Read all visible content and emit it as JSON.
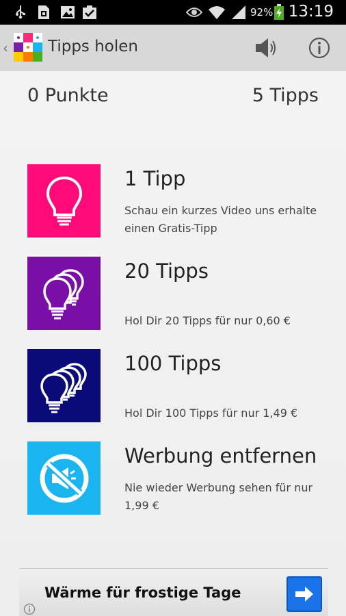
{
  "status_bar": {
    "battery_percent": "92%",
    "time": "13:19",
    "icons": [
      "usb-icon",
      "sim-icon",
      "gallery-icon",
      "task-icon",
      "eye-icon",
      "wifi-icon",
      "signal-icon",
      "battery-icon"
    ]
  },
  "action_bar": {
    "title": "Tipps holen",
    "icons": [
      "back-icon",
      "app-logo-icon",
      "sound-icon",
      "info-icon"
    ]
  },
  "score": {
    "points": "0 Punkte",
    "tips": "5 Tipps"
  },
  "items": [
    {
      "title": "1 Tipp",
      "description": "Schau ein kurzes Video uns erhalte einen Gratis-Tipp",
      "color": "#ff0a78",
      "icon": "lightbulb-icon"
    },
    {
      "title": "20 Tipps",
      "description": "Hol Dir 20 Tipps für nur 0,60 €",
      "color": "#7a0fa8",
      "icon": "lightbulbs-icon"
    },
    {
      "title": "100 Tipps",
      "description": "Hol Dir 100 Tipps für nur 1,49 €",
      "color": "#0a0a78",
      "icon": "many-lightbulbs-icon"
    },
    {
      "title": "Werbung entfernen",
      "description": "Nie wieder Werbung sehen für nur 1,99 €",
      "color": "#1ab4f0",
      "icon": "no-ads-icon"
    }
  ],
  "ad": {
    "text": "Wärme für frostige Tage",
    "icons": [
      "arrow-right-icon",
      "ad-info-icon"
    ]
  }
}
